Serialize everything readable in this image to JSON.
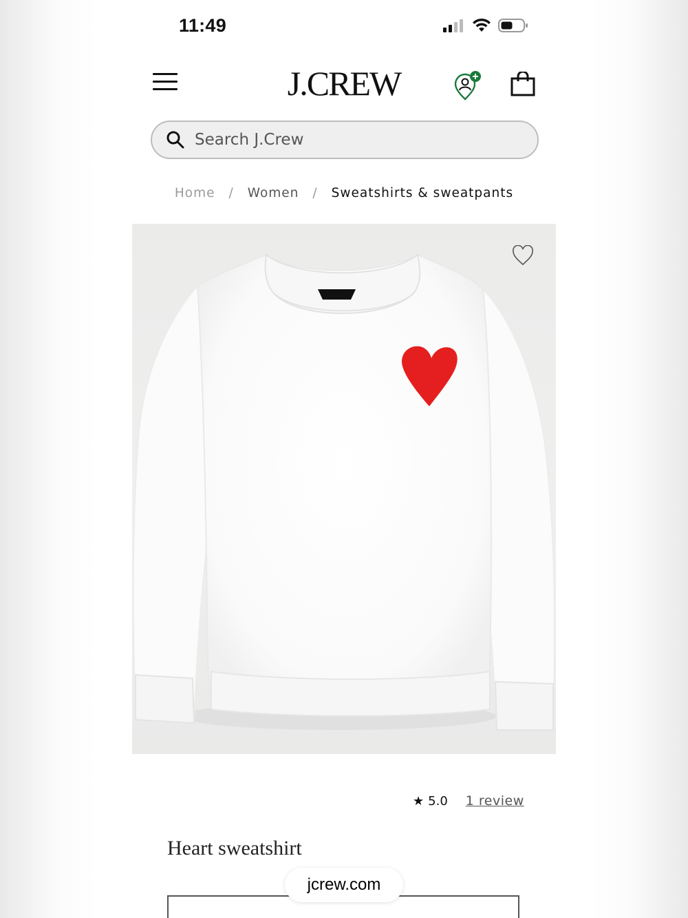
{
  "status_bar": {
    "time": "11:49",
    "battery_level": 0.5
  },
  "header": {
    "logo": "J.CREW",
    "icons": [
      "menu-icon",
      "profile-icon",
      "shopping-bag-icon"
    ],
    "accent_color": "#1a7a3c"
  },
  "search": {
    "placeholder": "Search J.Crew",
    "value": ""
  },
  "breadcrumb": {
    "home": "Home",
    "separator": "/",
    "women": "Women",
    "current": "Sweatshirts & sweatpants"
  },
  "product": {
    "rating_star": "★",
    "rating": "5.0",
    "review_link": "1 review",
    "title": "Heart sweatshirt",
    "image_desc_colors": {
      "sweatshirt": "#ffffff",
      "heart": "#e51f1f"
    }
  },
  "browser": {
    "url": "jcrew.com"
  }
}
